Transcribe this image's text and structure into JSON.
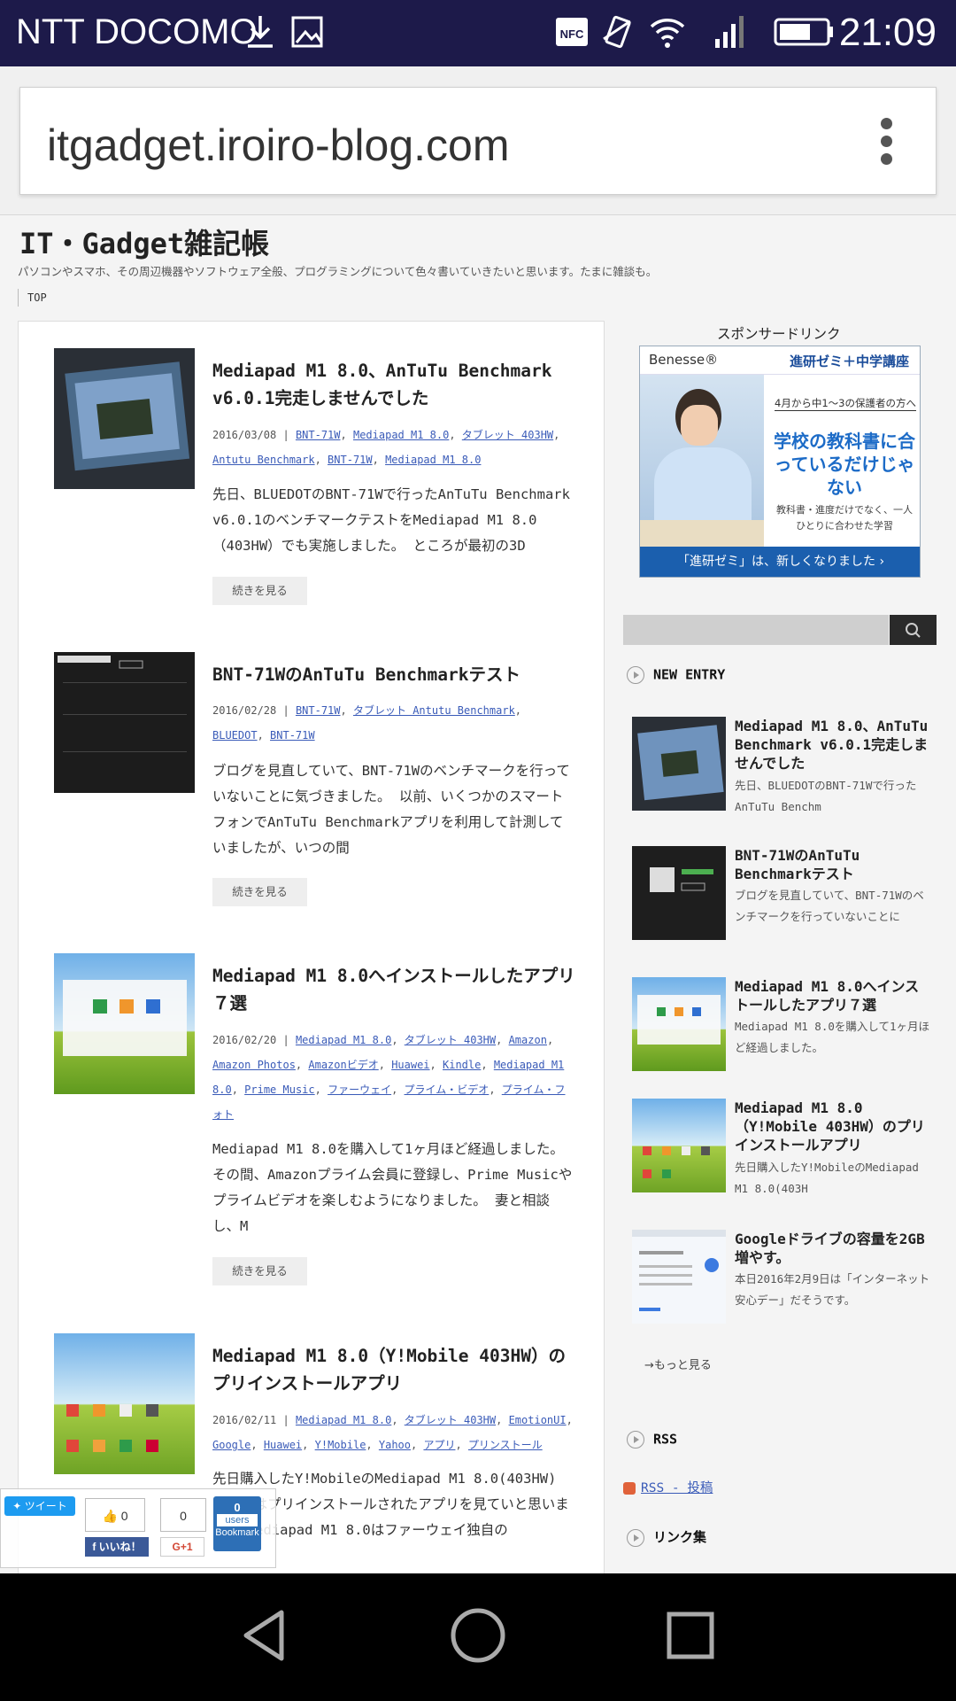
{
  "status_bar": {
    "carrier": "NTT DOCOMO",
    "time": "21:09",
    "icons": [
      "download-icon",
      "image-icon",
      "nfc-icon",
      "vibrate-icon",
      "wifi-icon",
      "signal-icon",
      "battery-icon"
    ]
  },
  "browser": {
    "url": "itgadget.iroiro-blog.com",
    "menu_icon": "more-vert-icon"
  },
  "blog": {
    "title": "IT・Gadget雑記帳",
    "description": "パソコンやスマホ、その周辺機器やソフトウェア全般、プログラミングについて色々書いていきたいと思います。たまに雑談も。",
    "nav_top": "TOP"
  },
  "posts": [
    {
      "title": "Mediapad M1 8.0、AnTuTu Benchmark v6.0.1完走しませんでした",
      "date": "2016/03/08 |",
      "tags": [
        "BNT-71W",
        "Mediapad M1 8.0",
        "タブレット 403HW",
        "Antutu Benchmark",
        "BNT-71W",
        "Mediapad M1 8.0"
      ],
      "excerpt": "先日、BLUEDOTのBNT-71Wで行ったAnTuTu Benchmark v6.0.1のベンチマークテストをMediapad M1 8.0（403HW）でも実施しました。 ところが最初の3D",
      "more": "続きを見る"
    },
    {
      "title": "BNT-71WのAnTuTu Benchmarkテスト",
      "date": "2016/02/28 |",
      "tags": [
        "BNT-71W",
        "タブレット Antutu Benchmark",
        "BLUEDOT",
        "BNT-71W"
      ],
      "excerpt": "ブログを見直していて、BNT-71Wのベンチマークを行っていないことに気づきました。 以前、いくつかのスマートフォンでAnTuTu Benchmarkアプリを利用して計測していましたが、いつの間",
      "more": "続きを見る"
    },
    {
      "title": "Mediapad M1 8.0へインストールしたアプリ７選",
      "date": "2016/02/20 |",
      "tags": [
        "Mediapad M1 8.0",
        "タブレット 403HW",
        "Amazon",
        "Amazon Photos",
        "Amazonビデオ",
        "Huawei",
        "Kindle",
        "Mediapad M1 8.0",
        "Prime Music",
        "ファーウェイ",
        "プライム・ビデオ",
        "プライム・フォト"
      ],
      "excerpt": "Mediapad M1 8.0を購入して1ヶ月ほど経過しました。 その間、Amazonプライム会員に登録し、Prime Musicやプライムビデオを楽しむようになりました。 妻と相談し、M",
      "more": "続きを見る"
    },
    {
      "title": "Mediapad M1 8.0（Y!Mobile 403HW）のプリインストールアプリ",
      "date": "2016/02/11 |",
      "tags": [
        "Mediapad M1 8.0",
        "タブレット 403HW",
        "EmotionUI",
        "Google",
        "Huawei",
        "Y!Mobile",
        "Yahoo",
        "アプリ",
        "プリンストール"
      ],
      "excerpt": "先日購入したY!MobileのMediapad M1 8.0(403HW) で今回はプリインストールされたアプリを見ていと思います。 Mediapad M1 8.0はファーウェイ独自の"
    }
  ],
  "sidebar": {
    "sponsor_label": "スポンサードリンク",
    "ad": {
      "brand": "Benesse®",
      "course": "進研ゼミ＋中学講座",
      "line1": "4月から中1～3の保護者の方へ",
      "headline": "学校の教科書に合っているだけじゃない",
      "sub": "教科書・進度だけでなく、一人ひとりに合わせた学習",
      "footer": "「進研ゼミ」は、新しくなりました ›"
    },
    "search_icon": "search-icon",
    "new_entry_label": "NEW ENTRY",
    "entries": [
      {
        "title": "Mediapad M1 8.0、AnTuTu Benchmark v6.0.1完走しませんでした",
        "excerpt": "先日、BLUEDOTのBNT-71Wで行ったAnTuTu Benchm"
      },
      {
        "title": "BNT-71WのAnTuTu Benchmarkテスト",
        "excerpt": "ブログを見直していて、BNT-71Wのベンチマークを行っていないことに"
      },
      {
        "title": "Mediapad M1 8.0へインストールしたアプリ７選",
        "excerpt": "Mediapad M1 8.0を購入して1ヶ月ほど経過しました。"
      },
      {
        "title": "Mediapad M1 8.0（Y!Mobile 403HW）のプリインストールアプリ",
        "excerpt": "先日購入したY!MobileのMediapad M1 8.0(403H"
      },
      {
        "title": "Googleドライブの容量を2GB増やす。",
        "excerpt": "本日2016年2月9日は「インターネット安心デー」だそうです。"
      }
    ],
    "more_label": "→もっと見る",
    "rss_label": "RSS",
    "rss_link": "RSS - 投稿",
    "links_label": "リンク集"
  },
  "social": {
    "tweet": "ツイート",
    "like_count": "0",
    "share_count": "0",
    "hatena_count": "0",
    "hatena_users": "users",
    "hatena_label": "Bookmark",
    "fb_label": "いいね！",
    "gplus_label": "G+1"
  },
  "nav_bar": {
    "icons": [
      "back-icon",
      "home-icon",
      "recents-icon"
    ]
  }
}
